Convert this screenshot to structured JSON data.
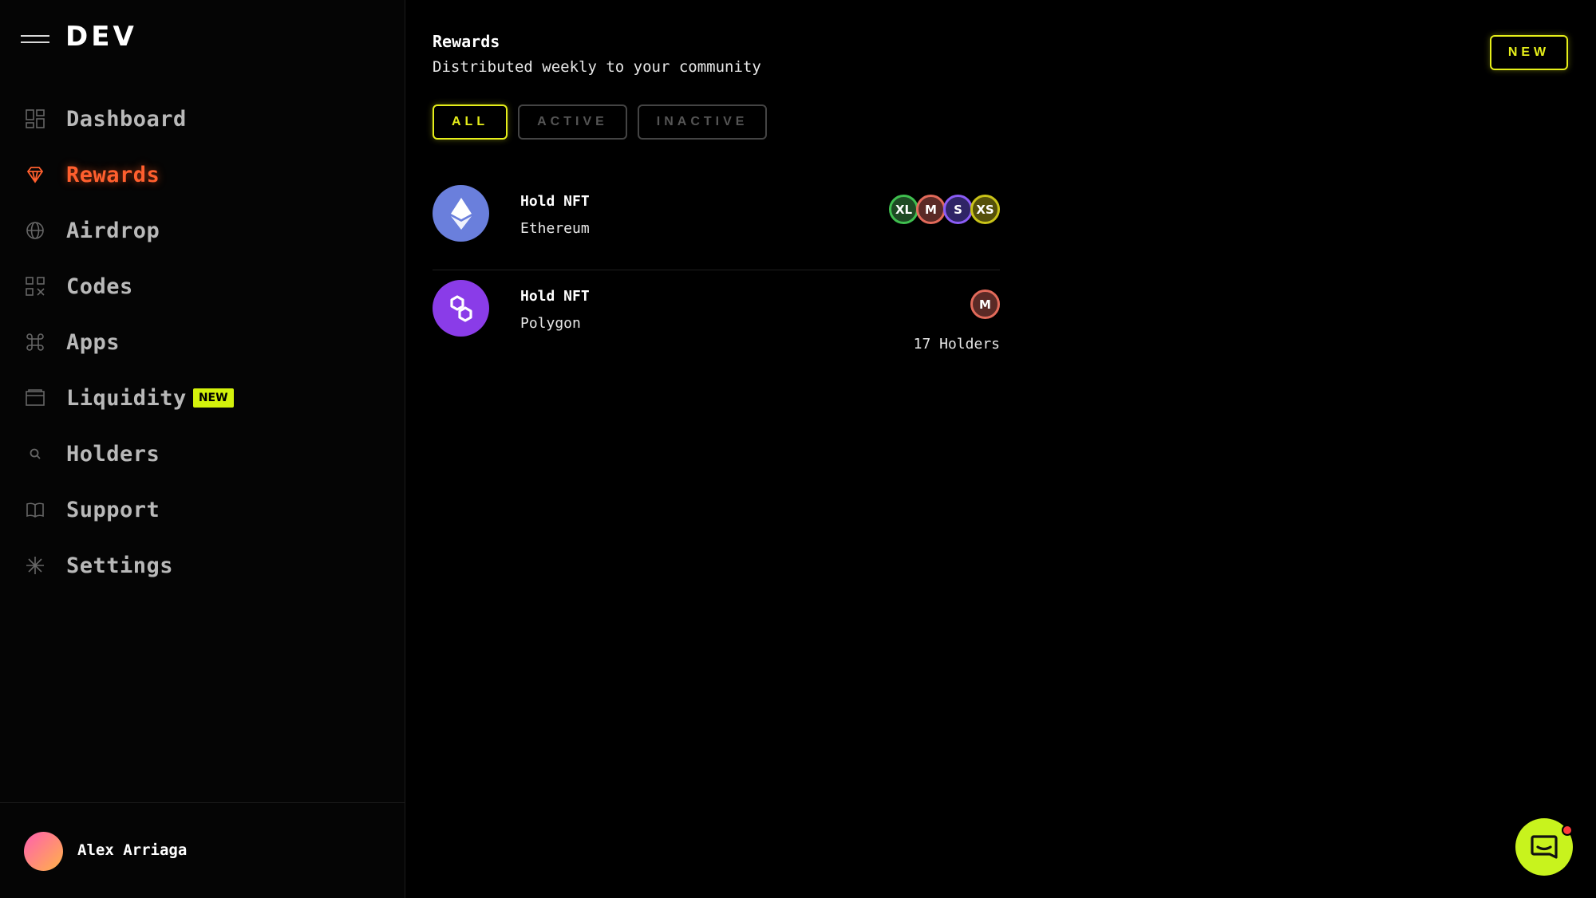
{
  "app": {
    "logo": "DEV"
  },
  "sidebar": {
    "items": [
      {
        "label": "Dashboard",
        "icon": "dashboard-icon"
      },
      {
        "label": "Rewards",
        "icon": "diamond-icon",
        "active": true
      },
      {
        "label": "Airdrop",
        "icon": "globe-icon"
      },
      {
        "label": "Codes",
        "icon": "qr-code-icon"
      },
      {
        "label": "Apps",
        "icon": "command-icon"
      },
      {
        "label": "Liquidity",
        "icon": "wallet-icon",
        "badge": "NEW"
      },
      {
        "label": "Holders",
        "icon": "search-icon"
      },
      {
        "label": "Support",
        "icon": "book-icon"
      },
      {
        "label": "Settings",
        "icon": "asterisk-icon"
      }
    ],
    "user": {
      "name": "Alex Arriaga"
    }
  },
  "main": {
    "title": "Rewards",
    "subtitle": "Distributed weekly to your community",
    "new_button": "NEW",
    "filters": [
      {
        "label": "ALL",
        "active": true
      },
      {
        "label": "ACTIVE",
        "active": false
      },
      {
        "label": "INACTIVE",
        "active": false
      }
    ],
    "rewards": [
      {
        "title": "Hold NFT",
        "chain": "Ethereum",
        "icon": "ethereum-icon",
        "badges": [
          {
            "label": "XL",
            "color": "#3fbf4f"
          },
          {
            "label": "M",
            "color": "#e26a5a"
          },
          {
            "label": "S",
            "color": "#8b5cf6"
          },
          {
            "label": "XS",
            "color": "#c9c318"
          }
        ],
        "holders": ""
      },
      {
        "title": "Hold NFT",
        "chain": "Polygon",
        "icon": "polygon-icon",
        "badges": [
          {
            "label": "M",
            "color": "#e26a5a"
          }
        ],
        "holders": "17 Holders"
      }
    ]
  },
  "colors": {
    "accent": "#e6ef1a",
    "active_nav": "#ff5f2e",
    "chat": "#c8f31d"
  }
}
